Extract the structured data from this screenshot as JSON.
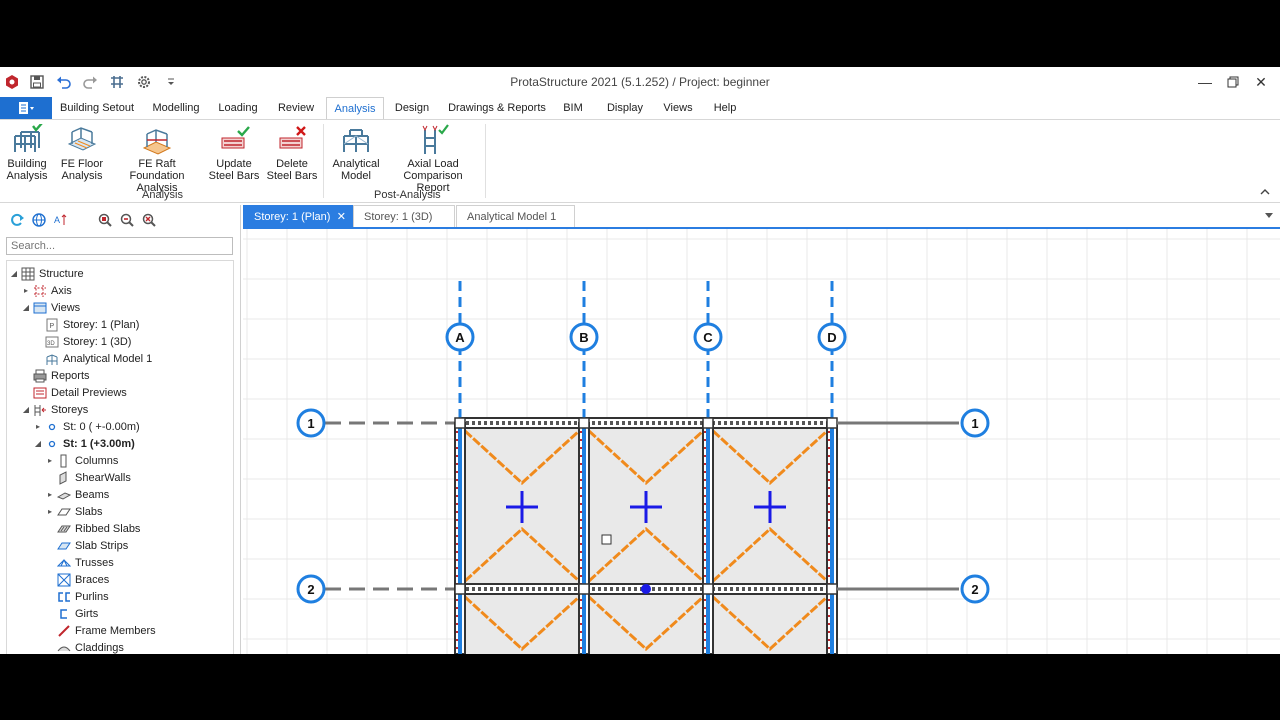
{
  "window": {
    "title": "ProtaStructure 2021 (5.1.252) / Project: beginner"
  },
  "menu": {
    "tabs": [
      "Building Setout",
      "Modelling",
      "Loading",
      "Review",
      "Analysis",
      "Design",
      "Drawings & Reports",
      "BIM",
      "Display",
      "Views",
      "Help"
    ],
    "active": "Analysis"
  },
  "ribbon": {
    "buttons": [
      {
        "line1": "Building",
        "line2": "Analysis"
      },
      {
        "line1": "FE Floor",
        "line2": "Analysis"
      },
      {
        "line1": "FE Raft Foundation",
        "line2": "Analysis"
      },
      {
        "line1": "Update",
        "line2": "Steel Bars"
      },
      {
        "line1": "Delete",
        "line2": "Steel Bars"
      },
      {
        "line1": "Analytical",
        "line2": "Model"
      },
      {
        "line1": "Axial Load",
        "line2": "Comparison Report"
      }
    ],
    "groups": [
      "Analysis",
      "Post-Analysis"
    ]
  },
  "sidebar": {
    "search_placeholder": "Search...",
    "tree": [
      {
        "label": "Structure",
        "icon": "structure-icon",
        "bold": false
      },
      {
        "label": "Axis",
        "icon": "axis-icon",
        "bold": false
      },
      {
        "label": "Views",
        "icon": "views-icon",
        "bold": false
      },
      {
        "label": "Storey: 1 (Plan)",
        "icon": "plan-view-icon",
        "bold": false
      },
      {
        "label": "Storey: 1 (3D)",
        "icon": "3d-view-icon",
        "bold": false
      },
      {
        "label": "Analytical Model 1",
        "icon": "analytical-model-icon",
        "bold": false
      },
      {
        "label": "Reports",
        "icon": "reports-icon",
        "bold": false
      },
      {
        "label": "Detail Previews",
        "icon": "detail-previews-icon",
        "bold": false
      },
      {
        "label": "Storeys",
        "icon": "storeys-icon",
        "bold": false
      },
      {
        "label": "St: 0 ( +-0.00m)",
        "icon": "storey-dot-icon",
        "bold": false
      },
      {
        "label": "St: 1 (+3.00m)",
        "icon": "storey-dot-icon",
        "bold": true
      },
      {
        "label": "Columns",
        "icon": "columns-icon",
        "bold": false
      },
      {
        "label": "ShearWalls",
        "icon": "shearwalls-icon",
        "bold": false
      },
      {
        "label": "Beams",
        "icon": "beams-icon",
        "bold": false
      },
      {
        "label": "Slabs",
        "icon": "slabs-icon",
        "bold": false
      },
      {
        "label": "Ribbed Slabs",
        "icon": "ribbed-slabs-icon",
        "bold": false
      },
      {
        "label": "Slab Strips",
        "icon": "slab-strips-icon",
        "bold": false
      },
      {
        "label": "Trusses",
        "icon": "trusses-icon",
        "bold": false
      },
      {
        "label": "Braces",
        "icon": "braces-icon",
        "bold": false
      },
      {
        "label": "Purlins",
        "icon": "purlins-icon",
        "bold": false
      },
      {
        "label": "Girts",
        "icon": "girts-icon",
        "bold": false
      },
      {
        "label": "Frame Members",
        "icon": "frame-members-icon",
        "bold": false
      },
      {
        "label": "Claddings",
        "icon": "claddings-icon",
        "bold": false
      }
    ]
  },
  "doc_tabs": [
    {
      "label": "Storey: 1 (Plan)",
      "active": true
    },
    {
      "label": "Storey: 1 (3D)",
      "active": false
    },
    {
      "label": "Analytical Model 1",
      "active": false
    }
  ],
  "drawing": {
    "column_axes": [
      "A",
      "B",
      "C",
      "D"
    ],
    "row_axes": [
      "1",
      "2"
    ],
    "colors": {
      "axis": "#1f7fe0",
      "slab_line": "#f08a1c",
      "beam": "#333333",
      "load_cross": "#1a1ae6",
      "grid": "#e8e8e8"
    }
  }
}
